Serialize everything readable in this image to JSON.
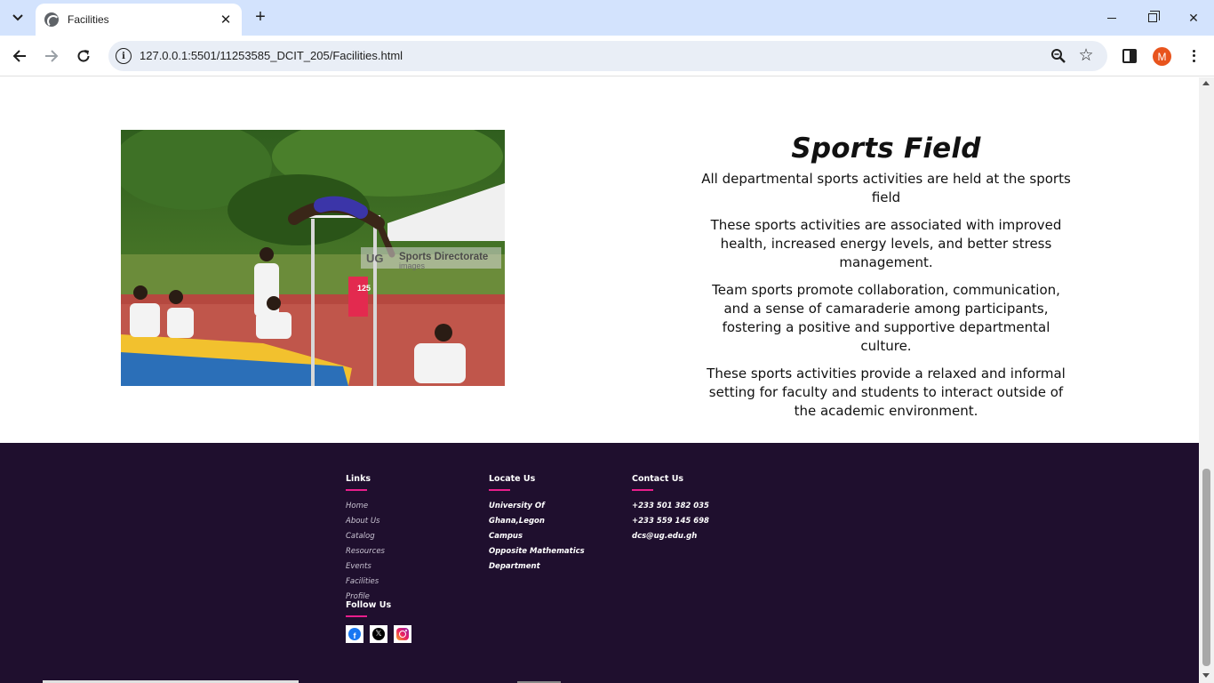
{
  "browser": {
    "tab_title": "Facilities",
    "url": "127.0.0.1:5501/11253585_DCIT_205/Facilities.html",
    "profile_initial": "M"
  },
  "facility": {
    "title": "Sports Field",
    "paragraphs": [
      "All departmental sports activities are held at the sports field",
      "These sports activities are associated with improved health, increased energy levels, and better stress management.",
      "Team sports promote collaboration, communication, and a sense of camaraderie among participants, fostering a positive and supportive departmental culture.",
      "These sports activities provide a relaxed and informal setting for faculty and students to interact outside of the academic environment."
    ],
    "image": {
      "watermark_logo": "UG",
      "watermark_title": "Sports Directorate",
      "watermark_sub": "images",
      "bib_number": "125",
      "icon": "high-jump-photo"
    }
  },
  "footer": {
    "links_heading": "Links",
    "links": [
      "Home",
      "About Us",
      "Catalog",
      "Resources",
      "Events",
      "Facilities",
      "Profile"
    ],
    "locate_heading": "Locate Us",
    "locate": [
      "University Of Ghana,Legon",
      "Campus",
      "Opposite Mathematics",
      "Department"
    ],
    "contact_heading": "Contact Us",
    "contact": [
      "+233 501 382 035",
      "+233 559 145 698",
      "dcs@ug.edu.gh"
    ],
    "follow_heading": "Follow Us",
    "social": [
      {
        "name": "facebook-icon",
        "glyph": "f"
      },
      {
        "name": "x-icon",
        "glyph": "𝕏"
      },
      {
        "name": "instagram-icon",
        "glyph": ""
      }
    ],
    "colors": {
      "background": "#1f0f2e",
      "accent": "#e91e8c"
    }
  }
}
